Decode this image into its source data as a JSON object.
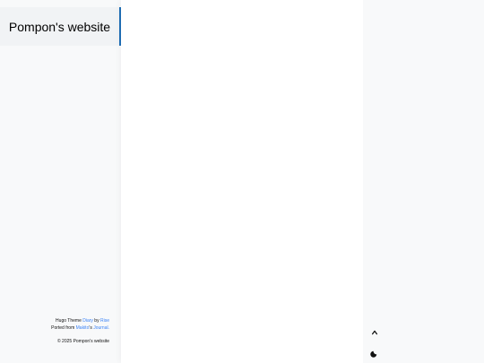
{
  "site": {
    "title": "Pompon's website"
  },
  "footer": {
    "theme_prefix": "Hugo Theme ",
    "theme_name": "Diary",
    "by_text": " by ",
    "author": "Rise",
    "ported_prefix": "Ported from ",
    "ported_author": "Makito",
    "ported_suffix": "'s ",
    "ported_project": "Journal.",
    "copyright": "© 2025 Pompon's website"
  },
  "icons": {
    "scroll_top": "chevron-up-icon",
    "dark_mode": "moon-icon"
  },
  "colors": {
    "accent": "#1f6fb7",
    "link": "#3b82f6"
  }
}
